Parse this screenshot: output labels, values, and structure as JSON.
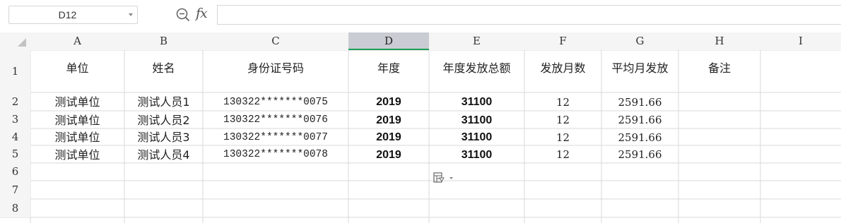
{
  "name_box": {
    "value": "D12"
  },
  "formula_bar": {
    "content": ""
  },
  "columns": [
    "A",
    "B",
    "C",
    "D",
    "E",
    "F",
    "G",
    "H",
    "I"
  ],
  "selected_column": "D",
  "rows": [
    "1",
    "2",
    "3",
    "4",
    "5",
    "6",
    "7",
    "8"
  ],
  "header_row": [
    "单位",
    "姓名",
    "身份证号码",
    "年度",
    "年度发放总额",
    "发放月数",
    "平均月发放",
    "备注",
    ""
  ],
  "data_rows": [
    [
      "测试单位",
      "测试人员1",
      "130322*******0075",
      "2019",
      "31100",
      "12",
      "2591.66",
      "",
      ""
    ],
    [
      "测试单位",
      "测试人员2",
      "130322*******0076",
      "2019",
      "31100",
      "12",
      "2591.66",
      "",
      ""
    ],
    [
      "测试单位",
      "测试人员3",
      "130322*******0077",
      "2019",
      "31100",
      "12",
      "2591.66",
      "",
      ""
    ],
    [
      "测试单位",
      "测试人员4",
      "130322*******0078",
      "2019",
      "31100",
      "12",
      "2591.66",
      "",
      ""
    ]
  ],
  "icons": [
    "zoom-formula-icon",
    "fx-icon",
    "paste-options-icon",
    "chevron-down-icon"
  ],
  "colors": {
    "grid_line": "#d8d8d8",
    "selected_header": "#c9ccd3",
    "selection_accent": "#1f9d55"
  }
}
